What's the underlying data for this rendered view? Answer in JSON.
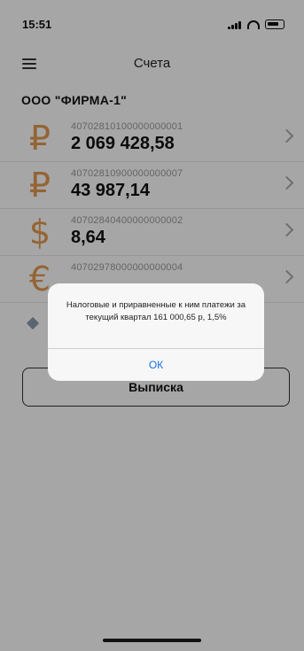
{
  "status_bar": {
    "time": "15:51"
  },
  "nav": {
    "title": "Счета"
  },
  "company": {
    "name": "ООО \"ФИРМА-1\""
  },
  "accounts": [
    {
      "currency_icon": "ruble-icon",
      "symbol": "₽",
      "number": "40702810100000000001",
      "balance": "2 069 428,58"
    },
    {
      "currency_icon": "ruble-icon",
      "symbol": "₽",
      "number": "40702810900000000007",
      "balance": "43 987,14"
    },
    {
      "currency_icon": "dollar-icon",
      "symbol": "$",
      "number": "40702840400000000002",
      "balance": "8,64"
    },
    {
      "currency_icon": "euro-icon",
      "symbol": "€",
      "number": "40702978000000000004",
      "balance": ""
    }
  ],
  "statement_button": {
    "label": "Выписка"
  },
  "alert": {
    "message": "Налоговые и приравненные к ним платежи за текущий квартал 161 000,65 р, 1,5%",
    "ok_label": "ОК"
  },
  "colors": {
    "currency_accent": "#e39a52",
    "alert_link": "#1a6fe0",
    "overlay": "rgba(0,0,0,0.35)"
  }
}
